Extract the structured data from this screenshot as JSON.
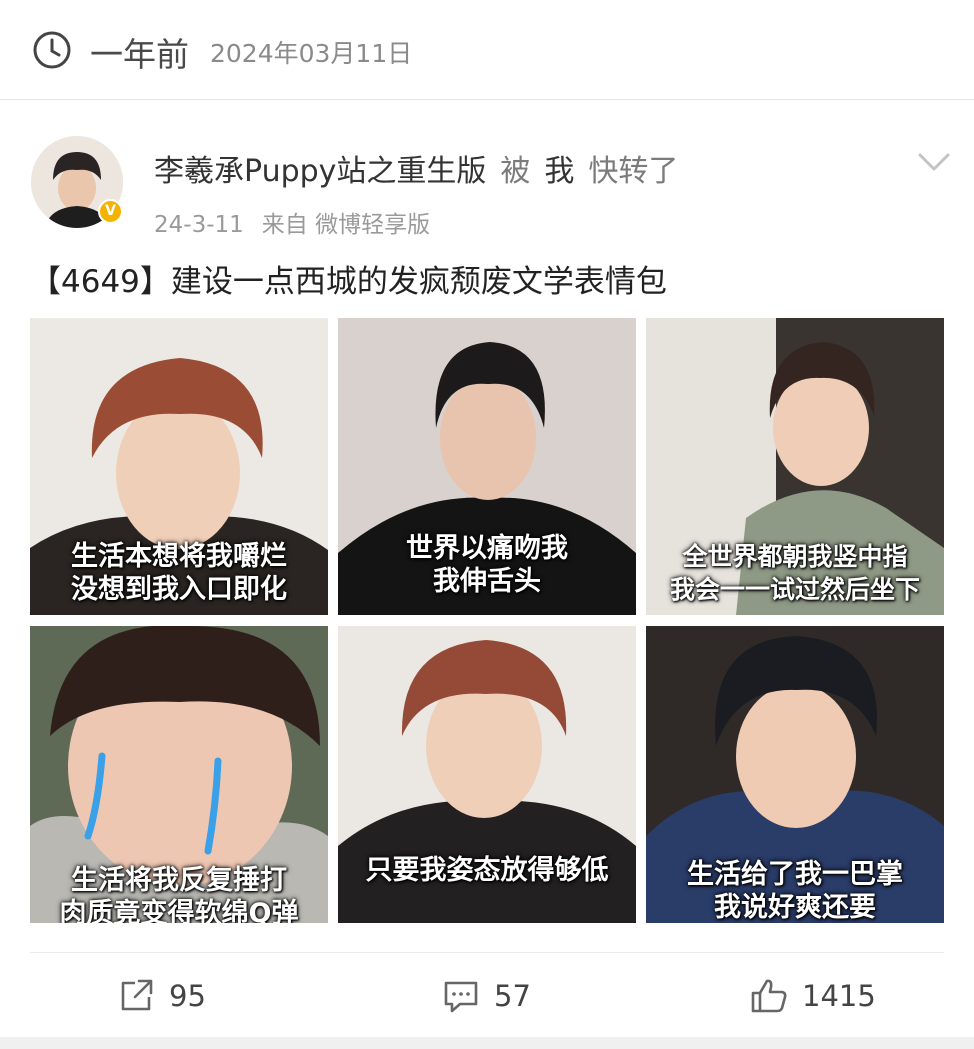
{
  "header": {
    "time_icon": "clock-icon",
    "relative_time": "一年前",
    "absolute_date": "2024年03月11日"
  },
  "post": {
    "source_user": "李羲承Puppy站之重生版",
    "by_label": "被",
    "reposter": "我",
    "action_label": "快转了",
    "date": "24-3-11",
    "via": "来自 微博轻享版",
    "verified_icon": "v-badge-icon",
    "text": "【4649】建设一点西城的发疯颓废文学表情包",
    "images": [
      {
        "caption_line1": "生活本想将我嚼烂",
        "caption_line2": "没想到我入口即化"
      },
      {
        "caption_line1": "世界以痛吻我",
        "caption_line2": "我伸舌头"
      },
      {
        "caption_line1": "全世界都朝我竖中指",
        "caption_line2": "我会一一试过然后坐下"
      },
      {
        "caption_line1": "生活将我反复捶打",
        "caption_line2": "肉质竟变得软绵Q弹"
      },
      {
        "caption_line1": "只要我姿态放得够低",
        "caption_line2": ""
      },
      {
        "caption_line1": "生活给了我一巴掌",
        "caption_line2": "我说好爽还要"
      }
    ]
  },
  "actions": {
    "share": {
      "icon": "share-icon",
      "count": "95"
    },
    "comment": {
      "icon": "comment-icon",
      "count": "57"
    },
    "like": {
      "icon": "thumbs-up-icon",
      "count": "1415"
    }
  }
}
